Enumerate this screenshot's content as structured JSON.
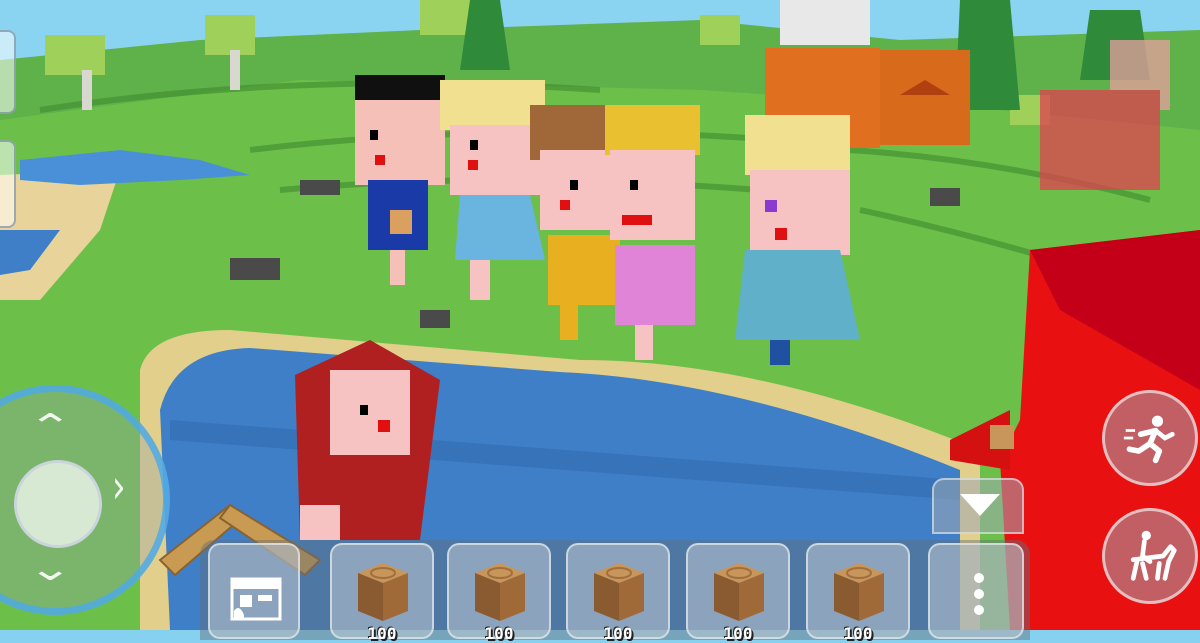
{
  "hotbar": {
    "slots": [
      {
        "item": "wood-log",
        "count": "100"
      },
      {
        "item": "wood-log",
        "count": "100"
      },
      {
        "item": "wood-log",
        "count": "100"
      },
      {
        "item": "wood-log",
        "count": "100"
      },
      {
        "item": "wood-log",
        "count": "100"
      }
    ]
  },
  "icons": {
    "run": "running-person-icon",
    "ride": "horse-rider-icon",
    "crafting": "crafting-table-icon",
    "menu": "more-vertical-icon",
    "collapse": "triangle-down-icon"
  },
  "colors": {
    "water": "#3f7fc8",
    "grass": "#6cc04a",
    "joystick_ring": "#50aae6",
    "red_building": "#e81010"
  }
}
